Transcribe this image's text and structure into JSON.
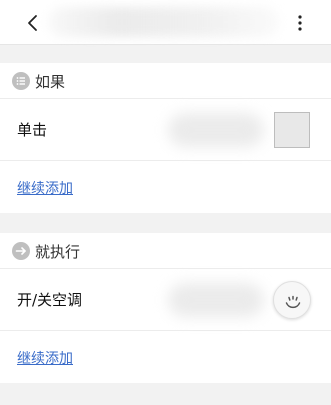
{
  "header": {
    "back": "back",
    "more": "more"
  },
  "if_section": {
    "title": "如果",
    "icon": "list-icon",
    "rows": [
      {
        "label": "单击"
      }
    ],
    "add_link": "继续添加"
  },
  "then_section": {
    "title": "就执行",
    "icon": "arrow-right-icon",
    "rows": [
      {
        "label": "开/关空调"
      }
    ],
    "add_link": "继续添加"
  },
  "colors": {
    "link": "#3a6cc9",
    "icon_gray": "#bfbfbf",
    "background": "#f2f2f2"
  }
}
